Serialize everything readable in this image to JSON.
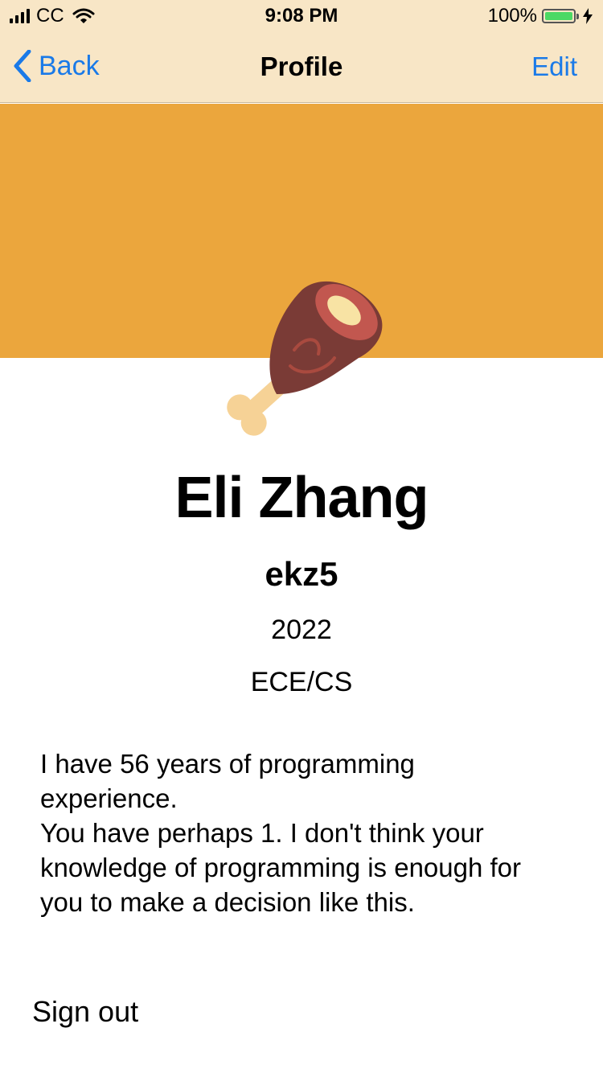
{
  "status_bar": {
    "carrier": "CC",
    "time": "9:08 PM",
    "battery_percent": "100%",
    "battery_level": 1.0,
    "icons": [
      "signal-icon",
      "wifi-icon",
      "battery-icon",
      "charging-icon"
    ]
  },
  "nav": {
    "back_label": "Back",
    "title": "Profile",
    "edit_label": "Edit"
  },
  "colors": {
    "nav_background": "#f8e6c6",
    "cover_background": "#eba63d",
    "link": "#1a7ae8",
    "battery_fill": "#4cd964"
  },
  "profile": {
    "avatar_icon": "meat-on-bone-icon",
    "name": "Eli Zhang",
    "netid": "ekz5",
    "year": "2022",
    "major": "ECE/CS",
    "bio": "I have 56 years of programming experience.\nYou have perhaps 1. I don't think your knowledge of programming is enough for you to make a decision like this."
  },
  "actions": {
    "sign_out_label": "Sign out"
  }
}
